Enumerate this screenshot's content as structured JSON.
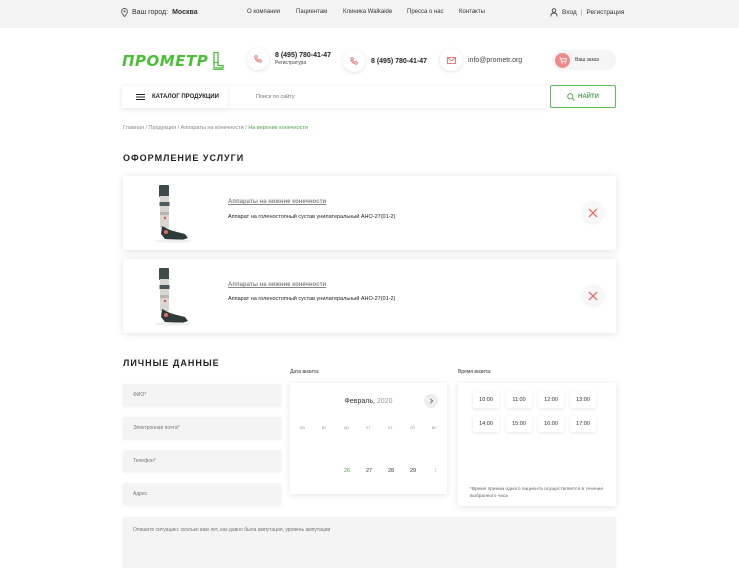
{
  "topbar": {
    "city_label": "Ваш город:",
    "city_value": "Москва",
    "nav": [
      "О компании",
      "Пациентам",
      "Клиника Walkaide",
      "Пресса о нас",
      "Контакты"
    ],
    "login": "Вход",
    "separator": "|",
    "register": "Регистрация"
  },
  "header": {
    "logo_text": "ПРОМЕТР",
    "phone1": "8 (495) 780-41-47",
    "phone1_sub": "Регистратура",
    "phone2": "8 (495) 780-41-47",
    "email": "info@prometr.org",
    "order_label": "Ваш заказ"
  },
  "search": {
    "catalog_label": "КАТАЛОГ ПРОДУКЦИИ",
    "placeholder": "Поиск по сайту",
    "button_label": "НАЙТИ"
  },
  "breadcrumb": {
    "items": [
      "Главная",
      "Продукция",
      "Аппараты на конечности"
    ],
    "separator": "/",
    "current": "На верхние конечности"
  },
  "order_section": {
    "title": "ОФОРМЛЕНИЕ УСЛУГИ",
    "items": [
      {
        "category": "Аппараты на нижние конечности",
        "description": "Аппарат на голеностопный сустав унилатеральный АНО-27(01-2)"
      },
      {
        "category": "Аппараты на нижние конечности",
        "description": "Аппарат на голеностопный сустав унилатеральный АНО-27(01-2)"
      }
    ]
  },
  "personal": {
    "title": "ЛИЧНЫЕ ДАННЫЕ",
    "fields": [
      "ФИО*",
      "Электронная почта*",
      "Телефон*",
      "Адрес"
    ],
    "textarea_placeholder": "Опишите ситуацию: сколько вам лет, как давно была ампутация, уровень ампутации"
  },
  "calendar": {
    "label": "Дата визита:",
    "month": "Февраль,",
    "year": "2020",
    "weekdays": [
      "пн",
      "вт",
      "ср",
      "чт",
      "пт",
      "сб",
      "вс"
    ],
    "days": [
      "26",
      "27",
      "28",
      "29",
      "1"
    ],
    "accent": "#48a846"
  },
  "time": {
    "label": "Время визита:",
    "slots": [
      "10:00",
      "11:00",
      "12:00",
      "13:00",
      "14:00",
      "15:00",
      "16:00",
      "17:00"
    ],
    "note": "*Время приема одного пациента осуществляется в течение выбранного часа"
  },
  "colors": {
    "brand_green": "#4bbf37",
    "remove_red": "#ec5d5d"
  }
}
